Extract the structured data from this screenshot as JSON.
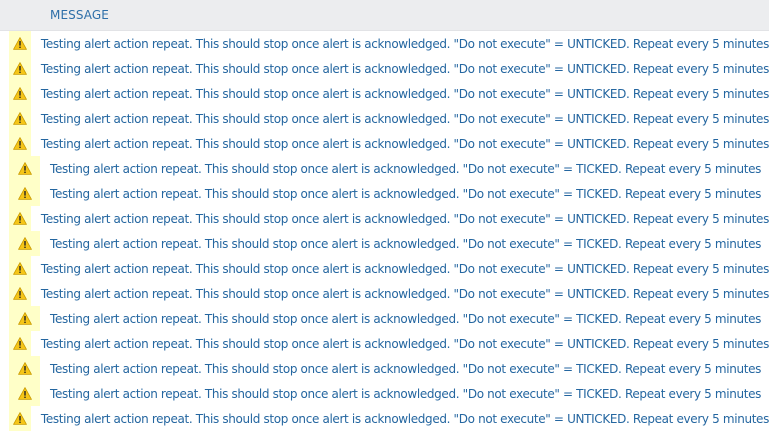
{
  "columns": {
    "message": "MESSAGE"
  },
  "icon": "warning-icon",
  "colors": {
    "header_bg": "#ecedef",
    "header_text": "#2e6fa8",
    "severity_bg": "#ffffc8",
    "warning_yellow": "#f5c518",
    "message_text": "#2466a0"
  },
  "rows": [
    {
      "message": "Testing alert action repeat. This should stop once alert is acknowledged. \"Do not execute\" = UNTICKED. Repeat every 5 minutes"
    },
    {
      "message": "Testing alert action repeat. This should stop once alert is acknowledged. \"Do not execute\" = UNTICKED. Repeat every 5 minutes"
    },
    {
      "message": "Testing alert action repeat. This should stop once alert is acknowledged. \"Do not execute\" = UNTICKED. Repeat every 5 minutes"
    },
    {
      "message": "Testing alert action repeat. This should stop once alert is acknowledged. \"Do not execute\" = UNTICKED. Repeat every 5 minutes"
    },
    {
      "message": "Testing alert action repeat. This should stop once alert is acknowledged. \"Do not execute\" = UNTICKED. Repeat every 5 minutes"
    },
    {
      "message": "Testing alert action repeat. This should stop once alert is acknowledged. \"Do not execute\" = TICKED. Repeat every 5 minutes"
    },
    {
      "message": "Testing alert action repeat. This should stop once alert is acknowledged. \"Do not execute\" = TICKED. Repeat every 5 minutes"
    },
    {
      "message": "Testing alert action repeat. This should stop once alert is acknowledged. \"Do not execute\" = UNTICKED. Repeat every 5 minutes"
    },
    {
      "message": "Testing alert action repeat. This should stop once alert is acknowledged. \"Do not execute\" = TICKED. Repeat every 5 minutes"
    },
    {
      "message": "Testing alert action repeat. This should stop once alert is acknowledged. \"Do not execute\" = UNTICKED. Repeat every 5 minutes"
    },
    {
      "message": "Testing alert action repeat. This should stop once alert is acknowledged. \"Do not execute\" = UNTICKED. Repeat every 5 minutes"
    },
    {
      "message": "Testing alert action repeat. This should stop once alert is acknowledged. \"Do not execute\" = TICKED. Repeat every 5 minutes"
    },
    {
      "message": "Testing alert action repeat. This should stop once alert is acknowledged. \"Do not execute\" = UNTICKED. Repeat every 5 minutes"
    },
    {
      "message": "Testing alert action repeat. This should stop once alert is acknowledged. \"Do not execute\" = TICKED. Repeat every 5 minutes"
    },
    {
      "message": "Testing alert action repeat. This should stop once alert is acknowledged. \"Do not execute\" = TICKED. Repeat every 5 minutes"
    },
    {
      "message": "Testing alert action repeat. This should stop once alert is acknowledged. \"Do not execute\" = UNTICKED. Repeat every 5 minutes"
    }
  ]
}
